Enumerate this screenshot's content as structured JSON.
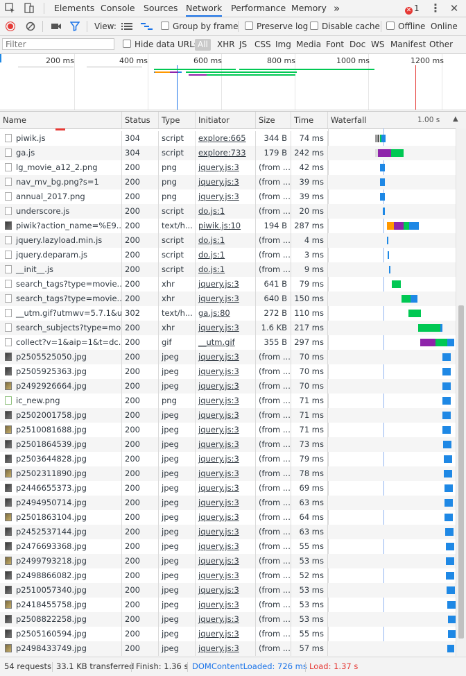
{
  "colors": {
    "accent": "#1a73e8",
    "error": "#e53935",
    "dom_content_loaded": "#1a73e8",
    "load": "#e53935",
    "waterfall_waiting": "#00c853",
    "waterfall_download": "#1e88e5",
    "waterfall_ssl": "#8e24aa",
    "waterfall_stalled": "#9e9e9e",
    "waterfall_dns": "#ff9800"
  },
  "tabs": {
    "elements": "Elements",
    "console": "Console",
    "sources": "Sources",
    "network": "Network",
    "performance": "Performance",
    "memory": "Memory",
    "more": "»"
  },
  "errors": {
    "count": "1"
  },
  "toolbar": {
    "view_label": "View:",
    "group_by_frame": "Group by frame",
    "preserve_log": "Preserve log",
    "disable_cache": "Disable cache",
    "offline": "Offline",
    "online": "Online"
  },
  "filter": {
    "placeholder": "Filter",
    "hide_data_urls": "Hide data URLs",
    "types": [
      "All",
      "XHR",
      "JS",
      "CSS",
      "Img",
      "Media",
      "Font",
      "Doc",
      "WS",
      "Manifest",
      "Other"
    ]
  },
  "overview": {
    "ticks": [
      "200 ms",
      "400 ms",
      "600 ms",
      "800 ms",
      "1000 ms",
      "1200 ms"
    ]
  },
  "table": {
    "headers": {
      "name": "Name",
      "status": "Status",
      "type": "Type",
      "initiator": "Initiator",
      "size": "Size",
      "time": "Time",
      "waterfall": "Waterfall",
      "waterfall_scale": "1.00 s"
    },
    "rows": [
      {
        "name": "piwik.js",
        "status": "304",
        "type": "script",
        "initiator": "explore:665",
        "size": "344 B",
        "time": "74 ms",
        "icon": "file-icon"
      },
      {
        "name": "ga.js",
        "status": "304",
        "type": "script",
        "initiator": "explore:733",
        "size": "179 B",
        "time": "242 ms",
        "icon": "file-icon"
      },
      {
        "name": "lg_movie_a12_2.png",
        "status": "200",
        "type": "png",
        "initiator": "jquery.js:3",
        "size": "(from ...",
        "time": "42 ms",
        "icon": "file-icon"
      },
      {
        "name": "nav_mv_bg.png?s=1",
        "status": "200",
        "type": "png",
        "initiator": "jquery.js:3",
        "size": "(from ...",
        "time": "39 ms",
        "icon": "file-icon"
      },
      {
        "name": "annual_2017.png",
        "status": "200",
        "type": "png",
        "initiator": "jquery.js:3",
        "size": "(from ...",
        "time": "39 ms",
        "icon": "file-icon"
      },
      {
        "name": "underscore.js",
        "status": "200",
        "type": "script",
        "initiator": "do.js:1",
        "size": "(from ...",
        "time": "20 ms",
        "icon": "file-icon"
      },
      {
        "name": "piwik?action_name=%E9...",
        "status": "200",
        "type": "text/h...",
        "initiator": "piwik.js:10",
        "size": "194 B",
        "time": "287 ms",
        "icon": "image-icon"
      },
      {
        "name": "jquery.lazyload.min.js",
        "status": "200",
        "type": "script",
        "initiator": "do.js:1",
        "size": "(from ...",
        "time": "4 ms",
        "icon": "file-icon"
      },
      {
        "name": "jquery.deparam.js",
        "status": "200",
        "type": "script",
        "initiator": "do.js:1",
        "size": "(from ...",
        "time": "3 ms",
        "icon": "file-icon"
      },
      {
        "name": "__init__.js",
        "status": "200",
        "type": "script",
        "initiator": "do.js:1",
        "size": "(from ...",
        "time": "9 ms",
        "icon": "file-icon"
      },
      {
        "name": "search_tags?type=movie...",
        "status": "200",
        "type": "xhr",
        "initiator": "jquery.js:3",
        "size": "641 B",
        "time": "79 ms",
        "icon": "file-icon"
      },
      {
        "name": "search_tags?type=movie...",
        "status": "200",
        "type": "xhr",
        "initiator": "jquery.js:3",
        "size": "640 B",
        "time": "150 ms",
        "icon": "file-icon"
      },
      {
        "name": "__utm.gif?utmwv=5.7.1&u...",
        "status": "302",
        "type": "text/h...",
        "initiator": "ga.js:80",
        "size": "272 B",
        "time": "110 ms",
        "icon": "file-icon"
      },
      {
        "name": "search_subjects?type=mo...",
        "status": "200",
        "type": "xhr",
        "initiator": "jquery.js:3",
        "size": "1.6 KB",
        "time": "217 ms",
        "icon": "file-icon"
      },
      {
        "name": "collect?v=1&aip=1&t=dc...",
        "status": "200",
        "type": "gif",
        "initiator": "__utm.gif",
        "size": "355 B",
        "time": "297 ms",
        "icon": "file-icon"
      },
      {
        "name": "p2505525050.jpg",
        "status": "200",
        "type": "jpeg",
        "initiator": "jquery.js:3",
        "size": "(from ...",
        "time": "70 ms",
        "icon": "image-icon"
      },
      {
        "name": "p2505925363.jpg",
        "status": "200",
        "type": "jpeg",
        "initiator": "jquery.js:3",
        "size": "(from ...",
        "time": "70 ms",
        "icon": "image-icon"
      },
      {
        "name": "p2492926664.jpg",
        "status": "200",
        "type": "jpeg",
        "initiator": "jquery.js:3",
        "size": "(from ...",
        "time": "70 ms",
        "icon": "image-icon"
      },
      {
        "name": "ic_new.png",
        "status": "200",
        "type": "png",
        "initiator": "jquery.js:3",
        "size": "(from ...",
        "time": "71 ms",
        "icon": "png-icon"
      },
      {
        "name": "p2502001758.jpg",
        "status": "200",
        "type": "jpeg",
        "initiator": "jquery.js:3",
        "size": "(from ...",
        "time": "71 ms",
        "icon": "image-icon"
      },
      {
        "name": "p2510081688.jpg",
        "status": "200",
        "type": "jpeg",
        "initiator": "jquery.js:3",
        "size": "(from ...",
        "time": "71 ms",
        "icon": "image-icon"
      },
      {
        "name": "p2501864539.jpg",
        "status": "200",
        "type": "jpeg",
        "initiator": "jquery.js:3",
        "size": "(from ...",
        "time": "73 ms",
        "icon": "image-icon"
      },
      {
        "name": "p2503644828.jpg",
        "status": "200",
        "type": "jpeg",
        "initiator": "jquery.js:3",
        "size": "(from ...",
        "time": "79 ms",
        "icon": "image-icon"
      },
      {
        "name": "p2502311890.jpg",
        "status": "200",
        "type": "jpeg",
        "initiator": "jquery.js:3",
        "size": "(from ...",
        "time": "78 ms",
        "icon": "image-icon"
      },
      {
        "name": "p2446655373.jpg",
        "status": "200",
        "type": "jpeg",
        "initiator": "jquery.js:3",
        "size": "(from ...",
        "time": "69 ms",
        "icon": "image-icon"
      },
      {
        "name": "p2494950714.jpg",
        "status": "200",
        "type": "jpeg",
        "initiator": "jquery.js:3",
        "size": "(from ...",
        "time": "63 ms",
        "icon": "image-icon"
      },
      {
        "name": "p2501863104.jpg",
        "status": "200",
        "type": "jpeg",
        "initiator": "jquery.js:3",
        "size": "(from ...",
        "time": "64 ms",
        "icon": "image-icon"
      },
      {
        "name": "p2452537144.jpg",
        "status": "200",
        "type": "jpeg",
        "initiator": "jquery.js:3",
        "size": "(from ...",
        "time": "63 ms",
        "icon": "image-icon"
      },
      {
        "name": "p2476693368.jpg",
        "status": "200",
        "type": "jpeg",
        "initiator": "jquery.js:3",
        "size": "(from ...",
        "time": "55 ms",
        "icon": "image-icon"
      },
      {
        "name": "p2499793218.jpg",
        "status": "200",
        "type": "jpeg",
        "initiator": "jquery.js:3",
        "size": "(from ...",
        "time": "53 ms",
        "icon": "image-icon"
      },
      {
        "name": "p2498866082.jpg",
        "status": "200",
        "type": "jpeg",
        "initiator": "jquery.js:3",
        "size": "(from ...",
        "time": "52 ms",
        "icon": "image-icon"
      },
      {
        "name": "p2510057340.jpg",
        "status": "200",
        "type": "jpeg",
        "initiator": "jquery.js:3",
        "size": "(from ...",
        "time": "53 ms",
        "icon": "image-icon"
      },
      {
        "name": "p2418455758.jpg",
        "status": "200",
        "type": "jpeg",
        "initiator": "jquery.js:3",
        "size": "(from ...",
        "time": "53 ms",
        "icon": "image-icon"
      },
      {
        "name": "p2508822258.jpg",
        "status": "200",
        "type": "jpeg",
        "initiator": "jquery.js:3",
        "size": "(from ...",
        "time": "53 ms",
        "icon": "image-icon"
      },
      {
        "name": "p2505160594.jpg",
        "status": "200",
        "type": "jpeg",
        "initiator": "jquery.js:3",
        "size": "(from ...",
        "time": "55 ms",
        "icon": "image-icon"
      },
      {
        "name": "p2498433749.jpg",
        "status": "200",
        "type": "jpeg",
        "initiator": "jquery.js:3",
        "size": "(from ...",
        "time": "57 ms",
        "icon": "image-icon"
      }
    ]
  },
  "status_bar": {
    "requests": "54 requests",
    "transferred": "33.1 KB transferred",
    "finish": "Finish: 1.36 s",
    "dom_content_loaded": "DOMContentLoaded: 726 ms",
    "load": "Load: 1.37 s"
  }
}
